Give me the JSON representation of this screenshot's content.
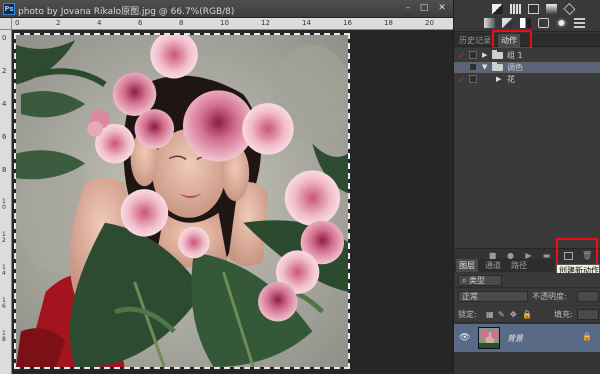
{
  "document": {
    "title": "photo by Jovana Rikalo原图.jpg @ 66.7%(RGB/8)",
    "app_icon": "Ps",
    "window_buttons": [
      "–",
      "□",
      "✕"
    ],
    "ruler_top_numbers": [
      "0",
      "2",
      "4",
      "6",
      "8",
      "10",
      "12",
      "14",
      "16",
      "18",
      "20"
    ],
    "ruler_left_numbers": [
      "0",
      "2",
      "4",
      "6",
      "8",
      "1 0",
      "1 2",
      "1 4",
      "1 6",
      "1 8"
    ]
  },
  "panels": {
    "adjustment_icons": [
      "brightness-contrast-icon",
      "levels-icon",
      "curves-icon",
      "exposure-icon",
      "vibrance-icon",
      "hue-saturation-icon",
      "color-balance-icon",
      "black-white-icon",
      "photo-filter-icon",
      "channel-mixer-icon",
      "color-lookup-icon"
    ],
    "history_tabs": [
      {
        "label": "历史记录",
        "active": false
      },
      {
        "label": "动作",
        "active": true
      }
    ],
    "actions": [
      {
        "label": "组 1",
        "type": "set",
        "expanded": false,
        "checked": true
      },
      {
        "label": "调色",
        "type": "set",
        "expanded": true,
        "checked": true,
        "selected": true
      },
      {
        "label": "花",
        "type": "action",
        "expanded": false,
        "checked": true
      }
    ],
    "tooltip": "创建新动作",
    "layers_tabs": [
      {
        "label": "图层",
        "active": true
      },
      {
        "label": "通道",
        "active": false
      },
      {
        "label": "路径",
        "active": false
      }
    ],
    "filter_kind": "类型",
    "blend_mode": "正常",
    "opacity_label": "不透明度:",
    "lock_label": "锁定:",
    "fill_label": "填充:",
    "layer": {
      "name": "背景",
      "visible": true,
      "locked": true
    }
  },
  "colors": {
    "highlight_red": "#e81010",
    "selection_blue": "#586a85"
  }
}
